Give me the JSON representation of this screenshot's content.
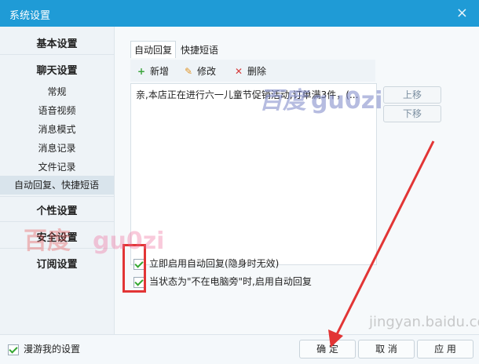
{
  "window": {
    "title": "系统设置",
    "close_glyph": "×"
  },
  "sidebar": {
    "basic": "基本设置",
    "chat": "聊天设置",
    "chat_items": [
      "常规",
      "语音视频",
      "消息模式",
      "消息记录",
      "文件记录",
      "自动回复、快捷短语"
    ],
    "personal": "个性设置",
    "security": "安全设置",
    "subscription": "订阅设置"
  },
  "tabs": [
    "自动回复",
    "快捷短语"
  ],
  "toolbar": {
    "add": "新增",
    "edit": "修改",
    "delete": "删除"
  },
  "reply_list": [
    "亲,本店正在进行六一儿童节促销活动,订单满3件，(..."
  ],
  "side_buttons": {
    "up": "上移",
    "down": "下移"
  },
  "options": {
    "enable_auto_reply": "立即启用自动回复(隐身时无效)",
    "enable_when_away": "当状态为\"不在电脑旁\"时,启用自动回复"
  },
  "footer": {
    "roam_label": "漫游我的设置",
    "confirm": "确 定",
    "cancel": "取 消",
    "apply": "应 用"
  },
  "watermarks": {
    "left_cn": "百度",
    "left_latin": "gu0zi",
    "right_cn": "百度",
    "right_latin": "gu0zi",
    "corner": "jingyan.baidu.com"
  },
  "colors": {
    "accent": "#1f9bd6",
    "check": "#33a630",
    "highlight": "#e23535"
  }
}
